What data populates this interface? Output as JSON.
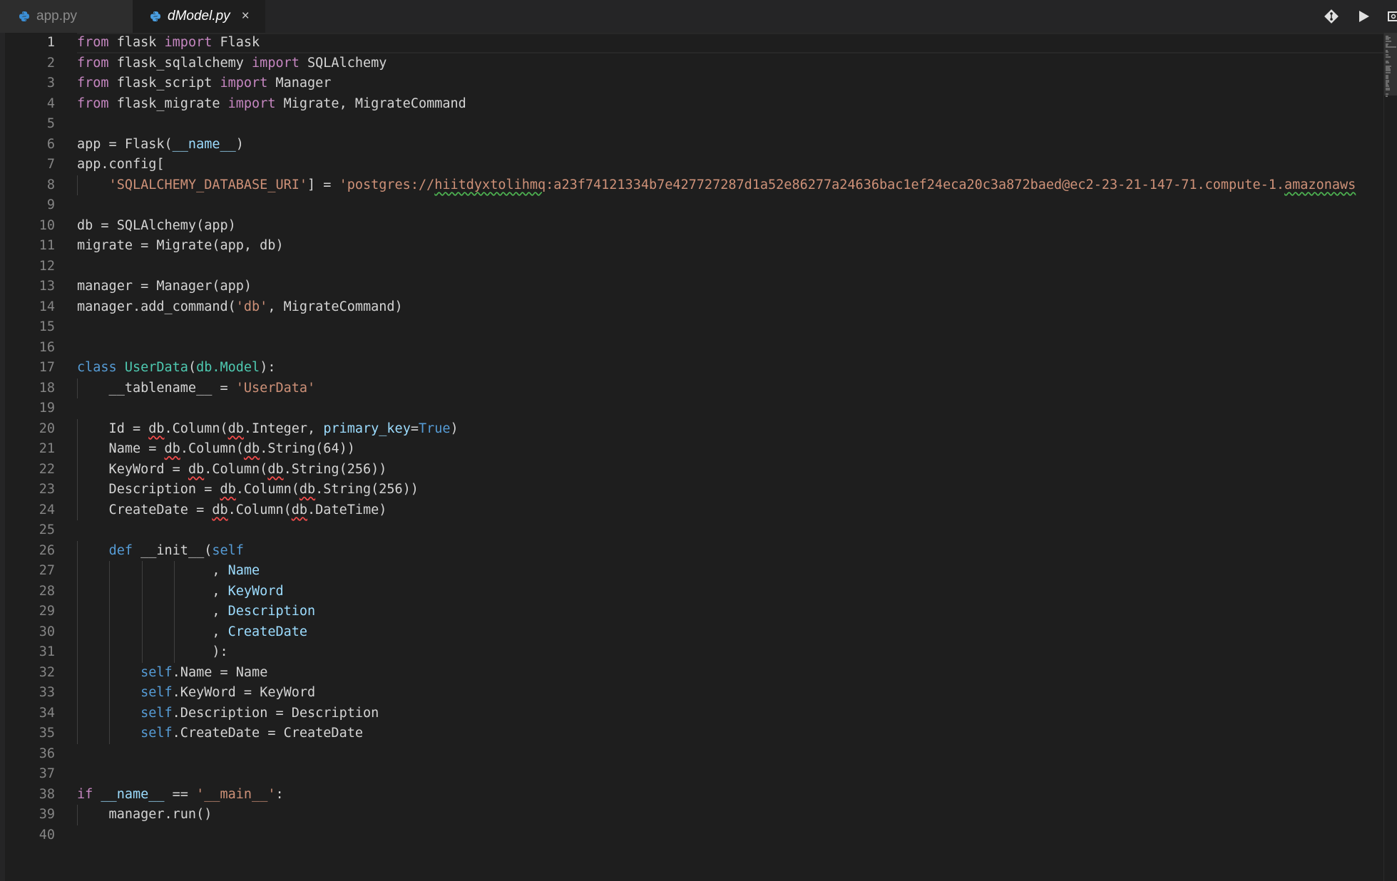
{
  "tabs": [
    {
      "label": "app.py",
      "active": false
    },
    {
      "label": "dModel.py",
      "active": true,
      "close_label": "×"
    }
  ],
  "actions": [
    "git-compare-icon",
    "run-icon",
    "split-editor-icon"
  ],
  "editor": {
    "current_line": 1,
    "line_numbers": [
      "1",
      "2",
      "3",
      "4",
      "5",
      "6",
      "7",
      "8",
      "9",
      "10",
      "11",
      "12",
      "13",
      "14",
      "15",
      "16",
      "17",
      "18",
      "19",
      "20",
      "21",
      "22",
      "23",
      "24",
      "25",
      "26",
      "27",
      "28",
      "29",
      "30",
      "31",
      "32",
      "33",
      "34",
      "35",
      "36",
      "37",
      "38",
      "39",
      "40"
    ],
    "lines": [
      [
        {
          "t": "from",
          "c": "kw"
        },
        {
          "t": " flask "
        },
        {
          "t": "import",
          "c": "kw"
        },
        {
          "t": " Flask"
        }
      ],
      [
        {
          "t": "from",
          "c": "kw"
        },
        {
          "t": " flask_sqlalchemy "
        },
        {
          "t": "import",
          "c": "kw"
        },
        {
          "t": " SQLAlchemy"
        }
      ],
      [
        {
          "t": "from",
          "c": "kw"
        },
        {
          "t": " flask_script "
        },
        {
          "t": "import",
          "c": "kw"
        },
        {
          "t": " Manager"
        }
      ],
      [
        {
          "t": "from",
          "c": "kw"
        },
        {
          "t": " flask_migrate "
        },
        {
          "t": "import",
          "c": "kw"
        },
        {
          "t": " Migrate, MigrateCommand"
        }
      ],
      [],
      [
        {
          "t": "app = Flask("
        },
        {
          "t": "__name__",
          "c": "pr"
        },
        {
          "t": ")"
        }
      ],
      [
        {
          "t": "app.config["
        }
      ],
      [
        {
          "t": "    "
        },
        {
          "t": "'SQLALCHEMY_DATABASE_URI'",
          "c": "st"
        },
        {
          "t": "] = "
        },
        {
          "t": "'postgres://",
          "c": "st"
        },
        {
          "t": "hiitdyxtolihmq",
          "c": "st warn"
        },
        {
          "t": ":a23f74121334b7e427727287d1a52e86277a24636bac1ef24eca20c3a872baed@ec2-23-21-147-71.compute-1.",
          "c": "st"
        },
        {
          "t": "amazonaws",
          "c": "st warn"
        }
      ],
      [],
      [
        {
          "t": "db = SQLAlchemy(app)"
        }
      ],
      [
        {
          "t": "migrate = Migrate(app, db)"
        }
      ],
      [],
      [
        {
          "t": "manager = Manager(app)"
        }
      ],
      [
        {
          "t": "manager.add_command("
        },
        {
          "t": "'db'",
          "c": "st"
        },
        {
          "t": ", MigrateCommand)"
        }
      ],
      [],
      [],
      [
        {
          "t": "class",
          "c": "bl"
        },
        {
          "t": " "
        },
        {
          "t": "UserData",
          "c": "cls"
        },
        {
          "t": "("
        },
        {
          "t": "db.Model",
          "c": "cls"
        },
        {
          "t": "):"
        }
      ],
      [
        {
          "t": "    __tablename__ = "
        },
        {
          "t": "'UserData'",
          "c": "st"
        }
      ],
      [],
      [
        {
          "t": "    Id = "
        },
        {
          "t": "db",
          "c": "err"
        },
        {
          "t": ".Column("
        },
        {
          "t": "db",
          "c": "err"
        },
        {
          "t": ".Integer, "
        },
        {
          "t": "primary_key",
          "c": "pr"
        },
        {
          "t": "="
        },
        {
          "t": "True",
          "c": "bl"
        },
        {
          "t": ")"
        }
      ],
      [
        {
          "t": "    Name = "
        },
        {
          "t": "db",
          "c": "err"
        },
        {
          "t": ".Column("
        },
        {
          "t": "db",
          "c": "err"
        },
        {
          "t": ".String(64))"
        }
      ],
      [
        {
          "t": "    KeyWord = "
        },
        {
          "t": "db",
          "c": "err"
        },
        {
          "t": ".Column("
        },
        {
          "t": "db",
          "c": "err"
        },
        {
          "t": ".String(256))"
        }
      ],
      [
        {
          "t": "    Description = "
        },
        {
          "t": "db",
          "c": "err"
        },
        {
          "t": ".Column("
        },
        {
          "t": "db",
          "c": "err"
        },
        {
          "t": ".String(256))"
        }
      ],
      [
        {
          "t": "    CreateDate = "
        },
        {
          "t": "db",
          "c": "err"
        },
        {
          "t": ".Column("
        },
        {
          "t": "db",
          "c": "err"
        },
        {
          "t": ".DateTime)"
        }
      ],
      [],
      [
        {
          "t": "    "
        },
        {
          "t": "def",
          "c": "bl"
        },
        {
          "t": " __init__("
        },
        {
          "t": "self",
          "c": "bl"
        }
      ],
      [
        {
          "t": "                 , "
        },
        {
          "t": "Name",
          "c": "pr"
        }
      ],
      [
        {
          "t": "                 , "
        },
        {
          "t": "KeyWord",
          "c": "pr"
        }
      ],
      [
        {
          "t": "                 , "
        },
        {
          "t": "Description",
          "c": "pr"
        }
      ],
      [
        {
          "t": "                 , "
        },
        {
          "t": "CreateDate",
          "c": "pr"
        }
      ],
      [
        {
          "t": "                 ):"
        }
      ],
      [
        {
          "t": "        "
        },
        {
          "t": "self",
          "c": "bl"
        },
        {
          "t": ".Name = Name"
        }
      ],
      [
        {
          "t": "        "
        },
        {
          "t": "self",
          "c": "bl"
        },
        {
          "t": ".KeyWord = KeyWord"
        }
      ],
      [
        {
          "t": "        "
        },
        {
          "t": "self",
          "c": "bl"
        },
        {
          "t": ".Description = Description"
        }
      ],
      [
        {
          "t": "        "
        },
        {
          "t": "self",
          "c": "bl"
        },
        {
          "t": ".CreateDate = CreateDate"
        }
      ],
      [],
      [],
      [
        {
          "t": "if",
          "c": "kw"
        },
        {
          "t": " "
        },
        {
          "t": "__name__",
          "c": "pr"
        },
        {
          "t": " == "
        },
        {
          "t": "'__main__'",
          "c": "st"
        },
        {
          "t": ":"
        }
      ],
      [
        {
          "t": "    manager.run()"
        }
      ],
      []
    ]
  }
}
